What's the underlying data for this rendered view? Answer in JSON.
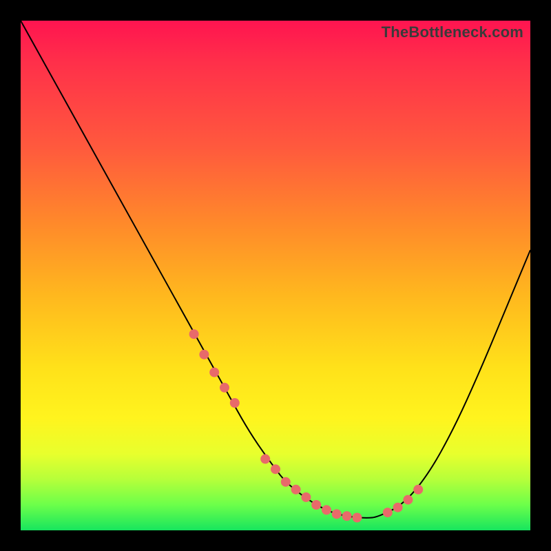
{
  "watermark": "TheBottleneck.com",
  "colors": {
    "frame": "#000000",
    "gradient_top": "#ff1450",
    "gradient_mid": "#ffe11a",
    "gradient_bottom": "#17e55e",
    "curve": "#000000",
    "dots": "#e86a6a"
  },
  "chart_data": {
    "type": "line",
    "title": "",
    "xlabel": "",
    "ylabel": "",
    "xlim": [
      0,
      100
    ],
    "ylim": [
      0,
      100
    ],
    "grid": false,
    "legend": false,
    "annotations": [
      "TheBottleneck.com"
    ],
    "series": [
      {
        "name": "bottleneck-curve",
        "x": [
          0,
          5,
          10,
          15,
          20,
          25,
          30,
          35,
          40,
          45,
          50,
          52,
          55,
          58,
          60,
          62,
          65,
          68,
          70,
          75,
          80,
          85,
          90,
          95,
          100
        ],
        "values": [
          100,
          91,
          82,
          73,
          64,
          55,
          46,
          37,
          28,
          19,
          12,
          9.5,
          7,
          5,
          4,
          3.2,
          2.6,
          2.4,
          2.6,
          5,
          11,
          20,
          31,
          43,
          55
        ]
      }
    ],
    "highlight_points": {
      "name": "marked-range",
      "x": [
        34,
        36,
        38,
        40,
        42,
        48,
        50,
        52,
        54,
        56,
        58,
        60,
        62,
        64,
        66,
        72,
        74,
        76,
        78
      ],
      "values": [
        38.5,
        34.5,
        31,
        28,
        25,
        14,
        12,
        9.5,
        8,
        6.5,
        5,
        4,
        3.2,
        2.8,
        2.5,
        3.5,
        4.5,
        6,
        8
      ]
    }
  }
}
